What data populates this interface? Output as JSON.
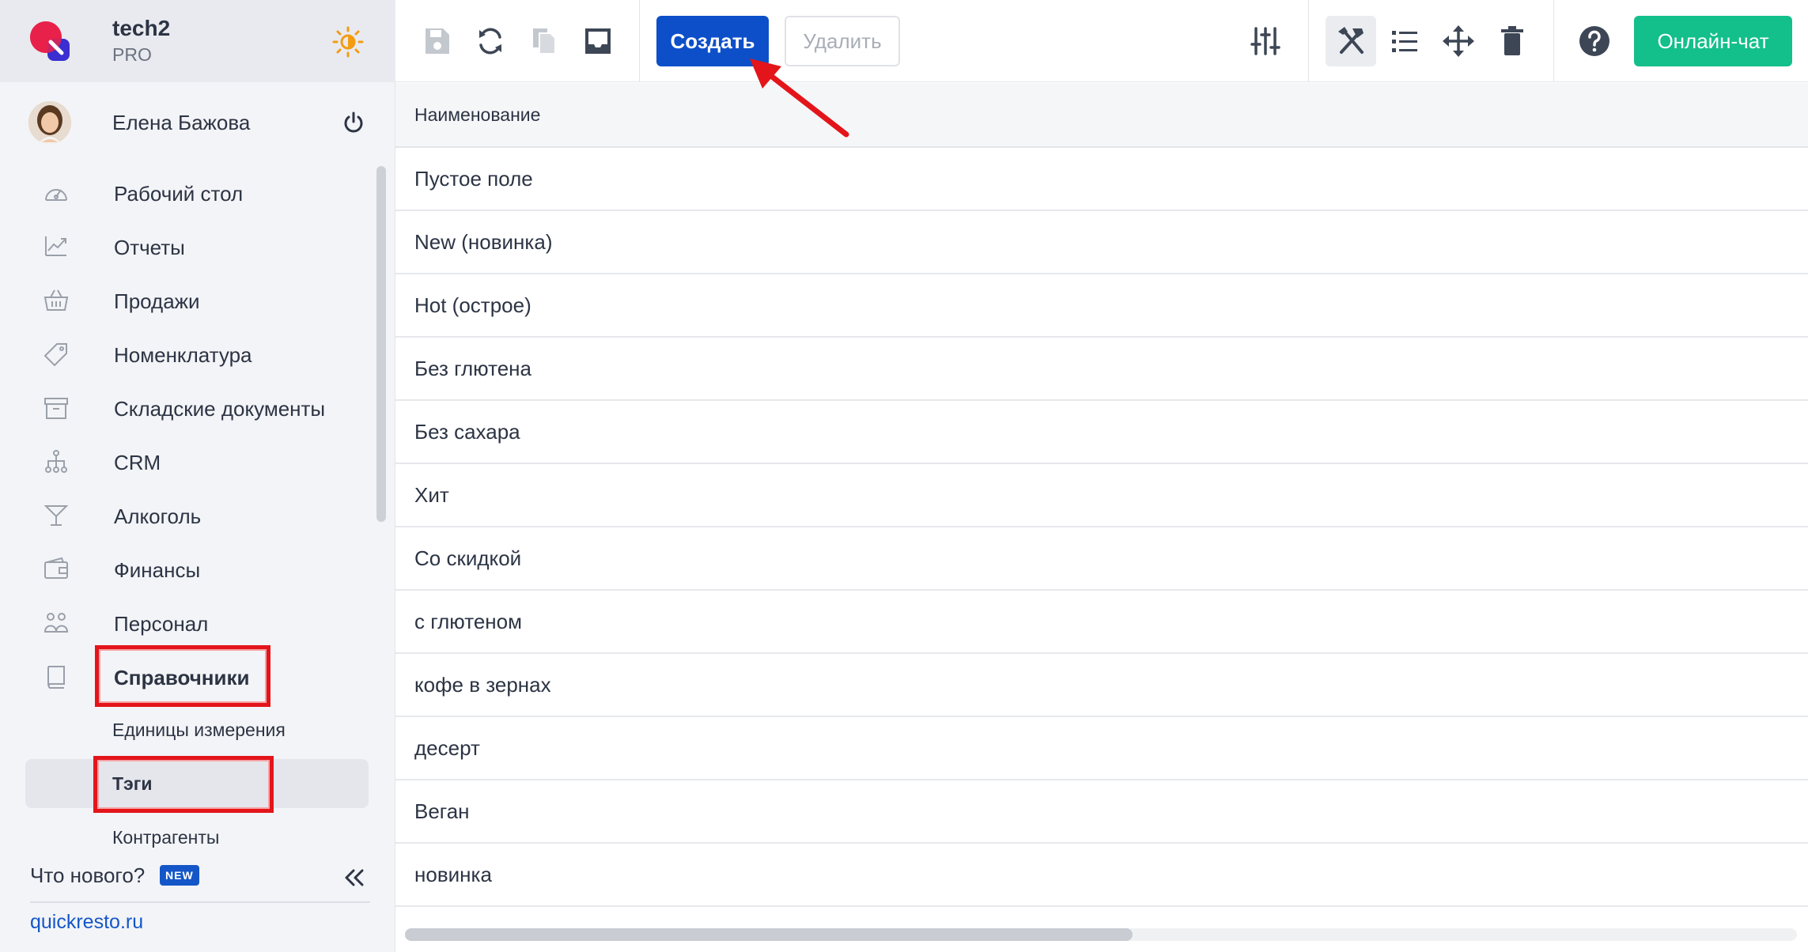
{
  "brand": {
    "company": "tech2",
    "plan": "PRO"
  },
  "user": {
    "name": "Елена Бажова"
  },
  "nav": {
    "items": [
      {
        "label": "Рабочий стол",
        "icon": "dashboard-icon"
      },
      {
        "label": "Отчеты",
        "icon": "chart-icon"
      },
      {
        "label": "Продажи",
        "icon": "basket-icon"
      },
      {
        "label": "Номенклатура",
        "icon": "tag-icon"
      },
      {
        "label": "Складские документы",
        "icon": "archive-icon"
      },
      {
        "label": "CRM",
        "icon": "hierarchy-icon"
      },
      {
        "label": "Алкоголь",
        "icon": "cocktail-icon"
      },
      {
        "label": "Финансы",
        "icon": "wallet-icon"
      },
      {
        "label": "Персонал",
        "icon": "people-icon"
      },
      {
        "label": "Справочники",
        "icon": "book-icon",
        "active": true
      }
    ],
    "subitems": [
      {
        "label": "Единицы измерения"
      },
      {
        "label": "Тэги",
        "selected": true
      },
      {
        "label": "Контрагенты"
      }
    ]
  },
  "footer": {
    "whats_new": "Что нового?",
    "new_badge": "NEW",
    "site": "quickresto.ru"
  },
  "toolbar": {
    "create_label": "Создать",
    "delete_label": "Удалить",
    "chat_label": "Онлайн-чат"
  },
  "table": {
    "column_header": "Наименование",
    "rows": [
      "Пустое поле",
      "New (новинка)",
      "Hot (острое)",
      "Без глютена",
      "Без сахара",
      "Хит",
      "Со скидкой",
      "с глютеном",
      "кофе в зернах",
      "десерт",
      "Веган",
      "новинка"
    ]
  },
  "colors": {
    "primary": "#0c4fc9",
    "chat": "#13bf8a",
    "highlight": "#e3151a",
    "link": "#1456c8"
  }
}
